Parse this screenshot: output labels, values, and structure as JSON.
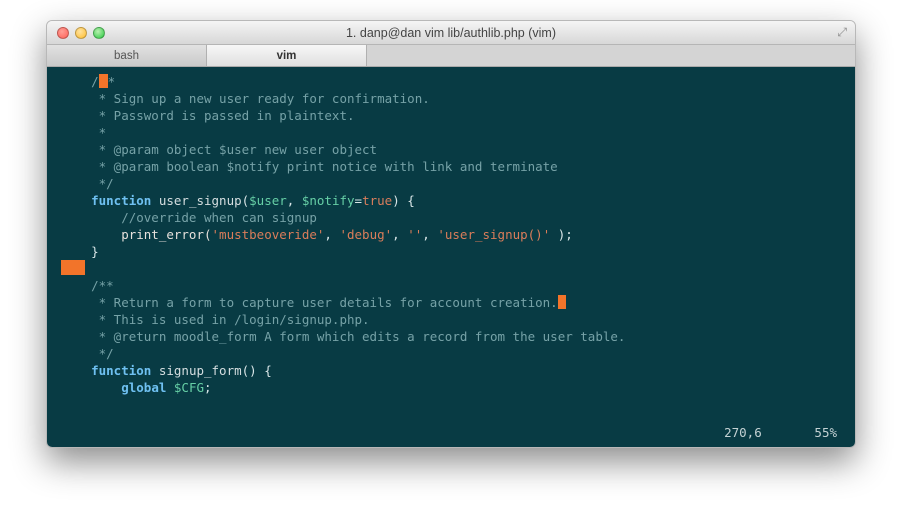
{
  "window": {
    "title": "1. danp@dan  vim lib/authlib.php (vim)"
  },
  "tabs": [
    {
      "label": "bash",
      "active": false
    },
    {
      "label": "vim",
      "active": true
    }
  ],
  "code": {
    "l01a": "    /",
    "l01b": "*",
    "l02": "     * Sign up a new user ready for confirmation.",
    "l03": "     * Password is passed in plaintext.",
    "l04": "     *",
    "l05": "     * @param object $user new user object",
    "l06": "     * @param boolean $notify print notice with link and terminate",
    "l07": "     */",
    "l08_kw": "    function",
    "l08_fn": " user_signup",
    "l08_p1": "(",
    "l08_v1": "$user",
    "l08_c1": ", ",
    "l08_v2": "$notify",
    "l08_eq": "=",
    "l08_tr": "true",
    "l08_p2": ") {",
    "l09": "        //override when can signup",
    "l10_a": "        print_error(",
    "l10_s1": "'mustbeoveride'",
    "l10_c1": ", ",
    "l10_s2": "'debug'",
    "l10_c2": ", ",
    "l10_s3": "''",
    "l10_c3": ", ",
    "l10_s4": "'user_signup()'",
    "l10_b": " );",
    "l11": "    }",
    "l12": "",
    "l13": "    /**",
    "l14": "     * Return a form to capture user details for account creation.",
    "l15": "     * This is used in /login/signup.php.",
    "l16": "     * @return moodle_form A form which edits a record from the user table.",
    "l17": "     */",
    "l18_kw": "    function",
    "l18_fn": " signup_form",
    "l18_p": "() {",
    "l19_a": "        ",
    "l19_kw": "global",
    "l19_sp": " ",
    "l19_v": "$CFG",
    "l19_b": ";"
  },
  "status": {
    "pos": "270,6",
    "pct": "55%"
  }
}
